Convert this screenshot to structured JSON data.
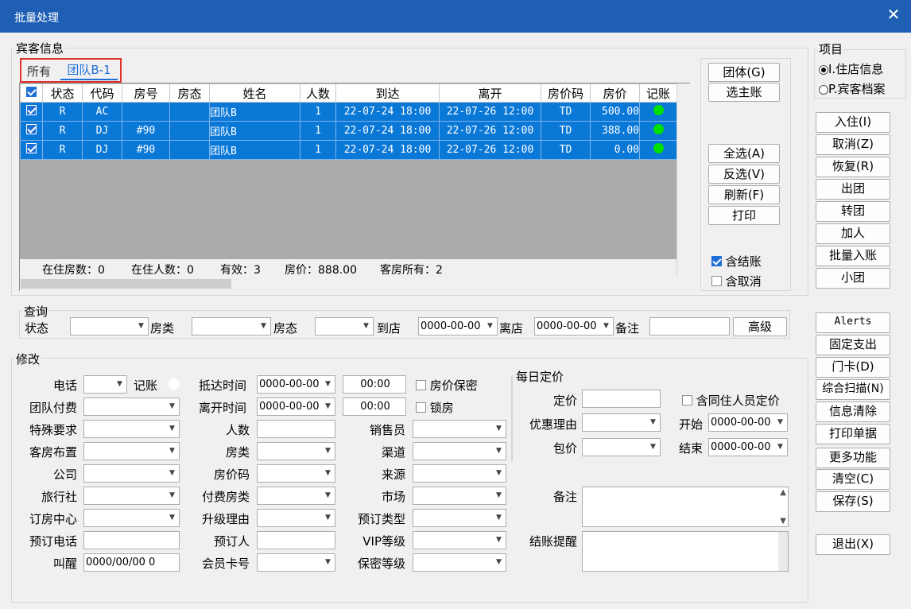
{
  "window": {
    "title": "批量处理",
    "close": "✕"
  },
  "guest": {
    "legend": "宾客信息",
    "tabs": [
      "所有",
      "团队B-1"
    ],
    "columns": [
      "状态",
      "代码",
      "房号",
      "房态",
      "姓名",
      "人数",
      "到达",
      "离开",
      "房价码",
      "房价",
      "记账"
    ],
    "rows": [
      {
        "status": "R",
        "code": "AC",
        "room": "",
        "roomstate": "",
        "name": "团队B",
        "persons": "1",
        "arrive": "22-07-24 18:00",
        "depart": "22-07-26 12:00",
        "ratecode": "TD",
        "rate": "500.00"
      },
      {
        "status": "R",
        "code": "DJ",
        "room": "#90",
        "roomstate": "",
        "name": "团队B",
        "persons": "1",
        "arrive": "22-07-24 18:00",
        "depart": "22-07-26 12:00",
        "ratecode": "TD",
        "rate": "388.00"
      },
      {
        "status": "R",
        "code": "DJ",
        "room": "#90",
        "roomstate": "",
        "name": "团队B",
        "persons": "1",
        "arrive": "22-07-24 18:00",
        "depart": "22-07-26 12:00",
        "ratecode": "TD",
        "rate": "0.00"
      }
    ],
    "summary": {
      "a": "在住房数：0",
      "b": "在住人数：0",
      "c": "有效：3",
      "d": "房价：888.00",
      "e": "客房所有：2"
    }
  },
  "gridButtons": {
    "group": "团体(G)",
    "master": "选主账",
    "selectAll": "全选(A)",
    "invert": "反选(V)",
    "refresh": "刷新(F)",
    "print": "打印",
    "incSettled": "含结账",
    "incCancel": "含取消"
  },
  "project": {
    "legend": "项目",
    "opt1": "I.住店信息",
    "opt2": "P.宾客档案"
  },
  "rightButtons": [
    "入住(I)",
    "取消(Z)",
    "恢复(R)",
    "出团",
    "转团",
    "加人",
    "批量入账",
    "小团"
  ],
  "rightButtons2": [
    "Alerts",
    "固定支出",
    "门卡(D)",
    "综合扫描(N)",
    "信息清除",
    "打印单据",
    "更多功能",
    "清空(C)",
    "保存(S)"
  ],
  "exit": "退出(X)",
  "query": {
    "legend": "查询",
    "status": "状态",
    "roomtype": "房类",
    "roomstate": "房态",
    "arrive": "到店",
    "arriveVal": "0000-00-00",
    "depart": "离店",
    "departVal": "0000-00-00",
    "remark": "备注",
    "advanced": "高级"
  },
  "modify": {
    "legend": "修改",
    "phone": "电话",
    "account": "记账",
    "arriveTime": "抵达时间",
    "arriveDate": "0000-00-00",
    "arriveClock": "00:00",
    "ratePrivate": "房价保密",
    "groupPay": "团队付费",
    "departTime": "离开时间",
    "departDate": "0000-00-00",
    "departClock": "00:00",
    "lockRoom": "锁房",
    "special": "特殊要求",
    "persons": "人数",
    "salesman": "销售员",
    "layout": "客房布置",
    "roomtype": "房类",
    "channel": "渠道",
    "company": "公司",
    "ratecode": "房价码",
    "source": "来源",
    "agency": "旅行社",
    "payRoomtype": "付费房类",
    "market": "市场",
    "bookingCenter": "订房中心",
    "upgrade": "升级理由",
    "bookingType": "预订类型",
    "bookingPhone": "预订电话",
    "booker": "预订人",
    "vip": "VIP等级",
    "wakeup": "叫醒",
    "wakeupVal": "0000/00/00 0",
    "memberCard": "会员卡号",
    "secret": "保密等级",
    "remark": "备注",
    "checkoutRemind": "结账提醒"
  },
  "daily": {
    "legend": "每日定价",
    "price": "定价",
    "incCompanion": "含同住人员定价",
    "reason": "优惠理由",
    "start": "开始",
    "startVal": "0000-00-00",
    "package": "包价",
    "end": "结束",
    "endVal": "0000-00-00"
  }
}
